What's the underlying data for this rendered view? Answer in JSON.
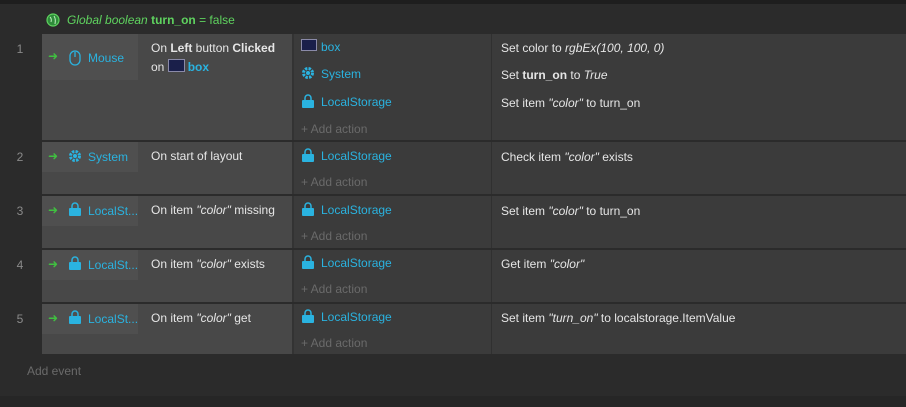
{
  "global_var": {
    "prefix": "Global boolean",
    "name": "turn_on",
    "suffix": "= false",
    "icon": "globe-icon"
  },
  "events": [
    {
      "number": "1",
      "condition_object": "Mouse",
      "condition_icon": "mouse-icon",
      "condition": {
        "pre": "On ",
        "b1": "Left",
        "mid": " button ",
        "b2": "Clicked",
        "line2": "on",
        "box": "box"
      },
      "actions": [
        {
          "object": "box",
          "icon": "box-swatch-icon",
          "text_pre": "Set color to ",
          "text_it": "rgbEx(100, 100, 0)",
          "text_post": ""
        },
        {
          "object": "System",
          "icon": "gear-icon",
          "text_pre": "Set ",
          "text_b": "turn_on",
          "text_mid": " to ",
          "text_it": "True"
        },
        {
          "object": "LocalStorage",
          "icon": "storage-icon",
          "text_pre": "Set item ",
          "text_it": "\"color\"",
          "text_post": " to turn_on"
        }
      ],
      "add_action": "+ Add action"
    },
    {
      "number": "2",
      "condition_object": "System",
      "condition_icon": "gear-icon",
      "condition_text": "On start of layout",
      "actions": [
        {
          "object": "LocalStorage",
          "icon": "storage-icon",
          "text_pre": "Check item ",
          "text_it": "\"color\"",
          "text_post": " exists"
        }
      ],
      "add_action": "+ Add action"
    },
    {
      "number": "3",
      "condition_object": "LocalSt...",
      "condition_icon": "storage-icon",
      "condition_pre": "On item ",
      "condition_it": "\"color\"",
      "condition_post": " missing",
      "actions": [
        {
          "object": "LocalStorage",
          "icon": "storage-icon",
          "text_pre": "Set item ",
          "text_it": "\"color\"",
          "text_post": " to turn_on"
        }
      ],
      "add_action": "+ Add action"
    },
    {
      "number": "4",
      "condition_object": "LocalSt...",
      "condition_icon": "storage-icon",
      "condition_pre": "On item ",
      "condition_it": "\"color\"",
      "condition_post": " exists",
      "actions": [
        {
          "object": "LocalStorage",
          "icon": "storage-icon",
          "text_pre": "Get item ",
          "text_it": "\"color\"",
          "text_post": ""
        }
      ],
      "add_action": "+ Add action"
    },
    {
      "number": "5",
      "condition_object": "LocalSt...",
      "condition_icon": "storage-icon",
      "condition_pre": "On item ",
      "condition_it": "\"color\"",
      "condition_post": " get",
      "actions": [
        {
          "object": "LocalStorage",
          "icon": "storage-icon",
          "text_pre": "Set item ",
          "text_it": "\"turn_on\"",
          "text_post": " to localstorage.ItemValue"
        }
      ],
      "add_action": "+ Add action"
    }
  ],
  "add_event": "Add event",
  "colors": {
    "object_name": "#2ab3e0",
    "trigger_arrow": "#40c040",
    "global_text": "#5fd35f"
  }
}
